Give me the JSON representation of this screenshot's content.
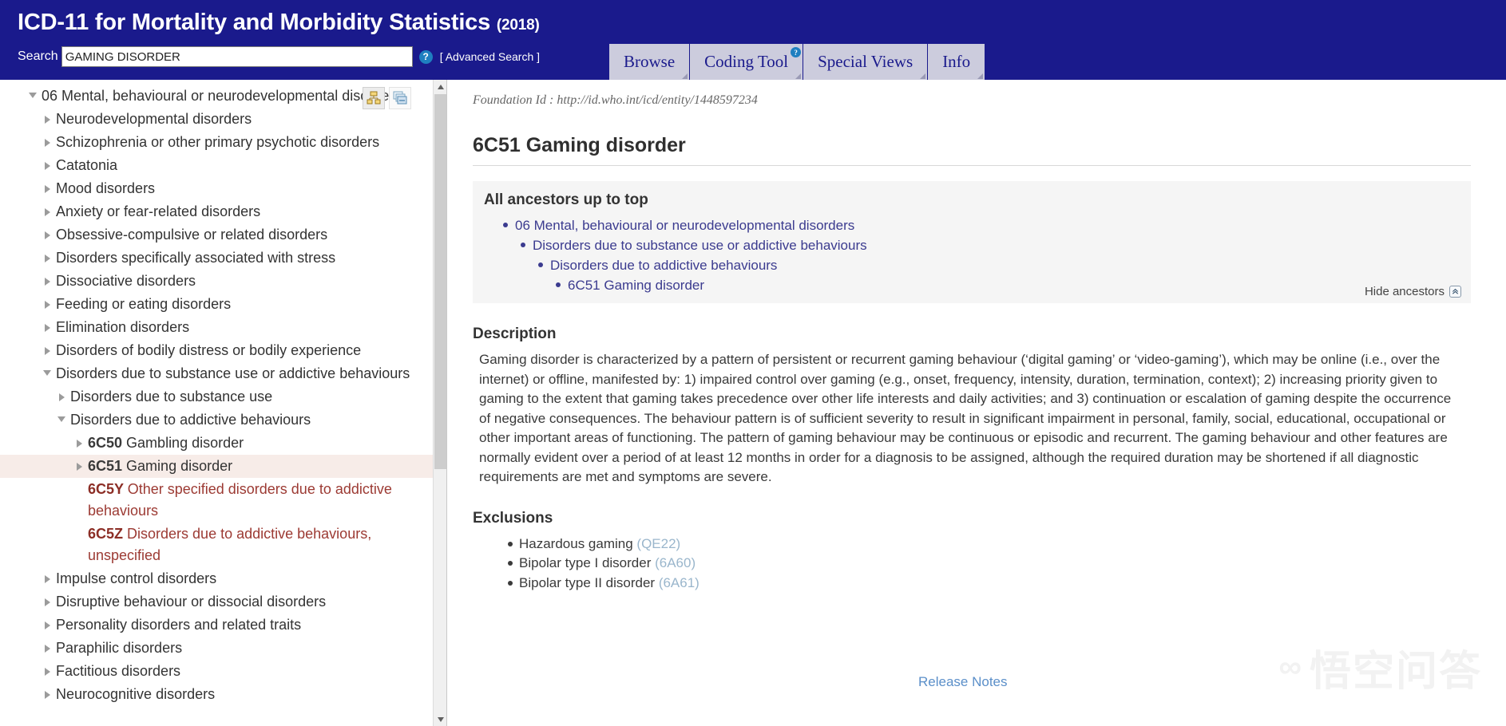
{
  "header": {
    "title": "ICD-11 for Mortality and Morbidity Statistics",
    "year": "(2018)",
    "search_label": "Search",
    "search_value": "GAMING DISORDER",
    "search_placeholder": "",
    "help_glyph": "?",
    "advanced_search": "[ Advanced Search ]",
    "accent_color": "#1a1a8c",
    "tab_bg_color": "#ccccdd"
  },
  "tabs": [
    {
      "label": "Browse",
      "help": false
    },
    {
      "label": "Coding Tool",
      "help": true,
      "help_glyph": "?"
    },
    {
      "label": "Special Views",
      "help": false
    },
    {
      "label": "Info",
      "help": false
    }
  ],
  "tree": {
    "toolbar": [
      {
        "icon": "hierarchy-icon"
      },
      {
        "icon": "stacked-windows-icon"
      }
    ],
    "items": [
      {
        "label": "06 Mental, behavioural or neurodevelopmental disorders",
        "level": 0,
        "state": "expanded",
        "selected": false,
        "style": "normal"
      },
      {
        "label": "Neurodevelopmental disorders",
        "level": 1,
        "state": "collapsed",
        "selected": false,
        "style": "normal"
      },
      {
        "label": "Schizophrenia or other primary psychotic disorders",
        "level": 1,
        "state": "collapsed",
        "selected": false,
        "style": "normal"
      },
      {
        "label": "Catatonia",
        "level": 1,
        "state": "collapsed",
        "selected": false,
        "style": "normal"
      },
      {
        "label": "Mood disorders",
        "level": 1,
        "state": "collapsed",
        "selected": false,
        "style": "normal"
      },
      {
        "label": "Anxiety or fear-related disorders",
        "level": 1,
        "state": "collapsed",
        "selected": false,
        "style": "normal"
      },
      {
        "label": "Obsessive-compulsive or related disorders",
        "level": 1,
        "state": "collapsed",
        "selected": false,
        "style": "normal"
      },
      {
        "label": "Disorders specifically associated with stress",
        "level": 1,
        "state": "collapsed",
        "selected": false,
        "style": "normal"
      },
      {
        "label": "Dissociative disorders",
        "level": 1,
        "state": "collapsed",
        "selected": false,
        "style": "normal"
      },
      {
        "label": "Feeding or eating disorders",
        "level": 1,
        "state": "collapsed",
        "selected": false,
        "style": "normal"
      },
      {
        "label": "Elimination disorders",
        "level": 1,
        "state": "collapsed",
        "selected": false,
        "style": "normal"
      },
      {
        "label": "Disorders of bodily distress or bodily experience",
        "level": 1,
        "state": "collapsed",
        "selected": false,
        "style": "normal"
      },
      {
        "label": "Disorders due to substance use or addictive behaviours",
        "level": 1,
        "state": "expanded",
        "selected": false,
        "style": "normal"
      },
      {
        "label": "Disorders due to substance use",
        "level": 2,
        "state": "collapsed",
        "selected": false,
        "style": "normal"
      },
      {
        "label": "Disorders due to addictive behaviours",
        "level": 2,
        "state": "expanded",
        "selected": false,
        "style": "normal"
      },
      {
        "code": "6C50",
        "label": "Gambling disorder",
        "level": 3,
        "state": "collapsed",
        "selected": false,
        "style": "code-black"
      },
      {
        "code": "6C51",
        "label": "Gaming disorder",
        "level": 3,
        "state": "collapsed",
        "selected": true,
        "style": "code-black"
      },
      {
        "code": "6C5Y",
        "label": "Other specified disorders due to addictive behaviours",
        "level": 3,
        "state": "none",
        "selected": false,
        "style": "red"
      },
      {
        "code": "6C5Z",
        "label": "Disorders due to addictive behaviours, unspecified",
        "level": 3,
        "state": "none",
        "selected": false,
        "style": "red"
      },
      {
        "label": "Impulse control disorders",
        "level": 1,
        "state": "collapsed",
        "selected": false,
        "style": "normal"
      },
      {
        "label": "Disruptive behaviour or dissocial disorders",
        "level": 1,
        "state": "collapsed",
        "selected": false,
        "style": "normal"
      },
      {
        "label": "Personality disorders and related traits",
        "level": 1,
        "state": "collapsed",
        "selected": false,
        "style": "normal"
      },
      {
        "label": "Paraphilic disorders",
        "level": 1,
        "state": "collapsed",
        "selected": false,
        "style": "normal"
      },
      {
        "label": "Factitious disorders",
        "level": 1,
        "state": "collapsed",
        "selected": false,
        "style": "normal"
      },
      {
        "label": "Neurocognitive disorders",
        "level": 1,
        "state": "collapsed",
        "selected": false,
        "style": "normal"
      }
    ]
  },
  "detail": {
    "foundation_id": "Foundation Id : http://id.who.int/icd/entity/1448597234",
    "entity_title": "6C51 Gaming disorder",
    "ancestors_title": "All ancestors up to top",
    "ancestors": [
      "06 Mental, behavioural or neurodevelopmental disorders",
      "Disorders due to substance use or addictive behaviours",
      "Disorders due to addictive behaviours",
      "6C51 Gaming disorder"
    ],
    "hide_ancestors_label": "Hide ancestors",
    "hide_ancestors_glyph": "»",
    "description_title": "Description",
    "description_text": "Gaming disorder is characterized by a pattern of persistent or recurrent gaming behaviour (‘digital gaming’ or ‘video-gaming’), which may be online (i.e., over the internet) or offline, manifested by: 1) impaired control over gaming (e.g., onset, frequency, intensity, duration, termination, context); 2) increasing priority given to gaming to the extent that gaming takes precedence over other life interests and daily activities; and 3) continuation or escalation of gaming despite the occurrence of negative consequences. The behaviour pattern is of sufficient severity to result in significant impairment in personal, family, social, educational, occupational or other important areas of functioning. The pattern of gaming behaviour may be continuous or episodic and recurrent. The gaming behaviour and other features are normally evident over a period of at least 12 months in order for a diagnosis to be assigned, although the required duration may be shortened if all diagnostic requirements are met and symptoms are severe.",
    "exclusions_title": "Exclusions",
    "exclusions": [
      {
        "label": "Hazardous gaming",
        "code": "(QE22)"
      },
      {
        "label": "Bipolar type I disorder",
        "code": "(6A60)"
      },
      {
        "label": "Bipolar type II disorder",
        "code": "(6A61)"
      }
    ],
    "release_notes": "Release Notes"
  },
  "watermark": {
    "text": "悟空问答",
    "mark": "∞"
  }
}
